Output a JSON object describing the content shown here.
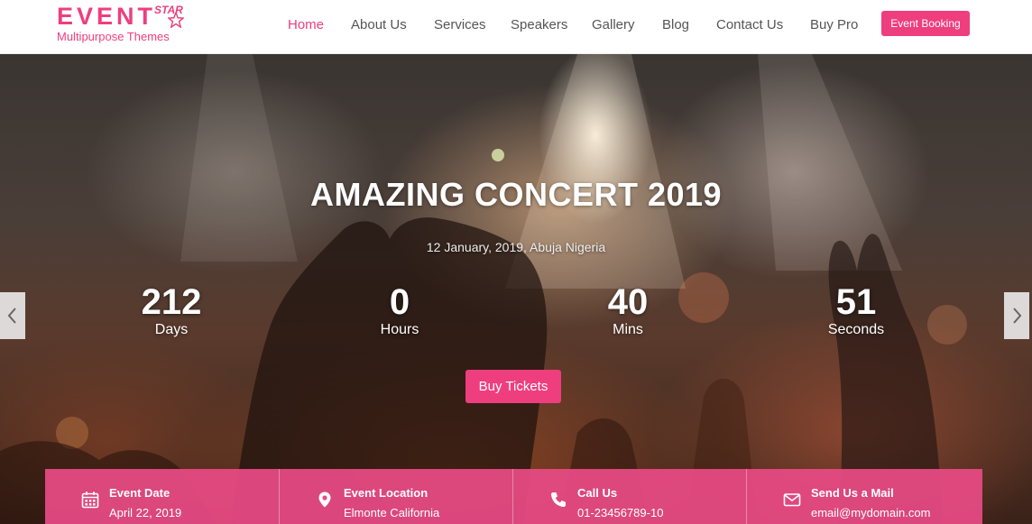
{
  "brand": {
    "logo_main": "EVENT",
    "logo_star": "STAR",
    "tagline": "Multipurpose Themes",
    "accent_color": "#ee3e7e"
  },
  "nav": {
    "items": [
      {
        "label": "Home",
        "active": true
      },
      {
        "label": "About Us"
      },
      {
        "label": "Services"
      },
      {
        "label": "Speakers"
      },
      {
        "label": "Gallery"
      },
      {
        "label": "Blog"
      },
      {
        "label": "Contact Us"
      },
      {
        "label": "Buy Pro"
      }
    ],
    "booking_button": "Event Booking"
  },
  "hero": {
    "title": "AMAZING CONCERT 2019",
    "subtitle": "12 January, 2019, Abuja Nigeria",
    "countdown": [
      {
        "value": "212",
        "label": "Days"
      },
      {
        "value": "0",
        "label": "Hours"
      },
      {
        "value": "40",
        "label": "Mins"
      },
      {
        "value": "51",
        "label": "Seconds"
      }
    ],
    "cta": "Buy Tickets",
    "prev_icon": "chevron-left-icon",
    "next_icon": "chevron-right-icon"
  },
  "info_bar": [
    {
      "icon": "calendar-icon",
      "title": "Event Date",
      "value": "April 22, 2019"
    },
    {
      "icon": "location-pin-icon",
      "title": "Event Location",
      "value": "Elmonte California"
    },
    {
      "icon": "phone-icon",
      "title": "Call Us",
      "value": "01-23456789-10"
    },
    {
      "icon": "envelope-icon",
      "title": "Send Us a Mail",
      "value": "email@mydomain.com"
    }
  ]
}
